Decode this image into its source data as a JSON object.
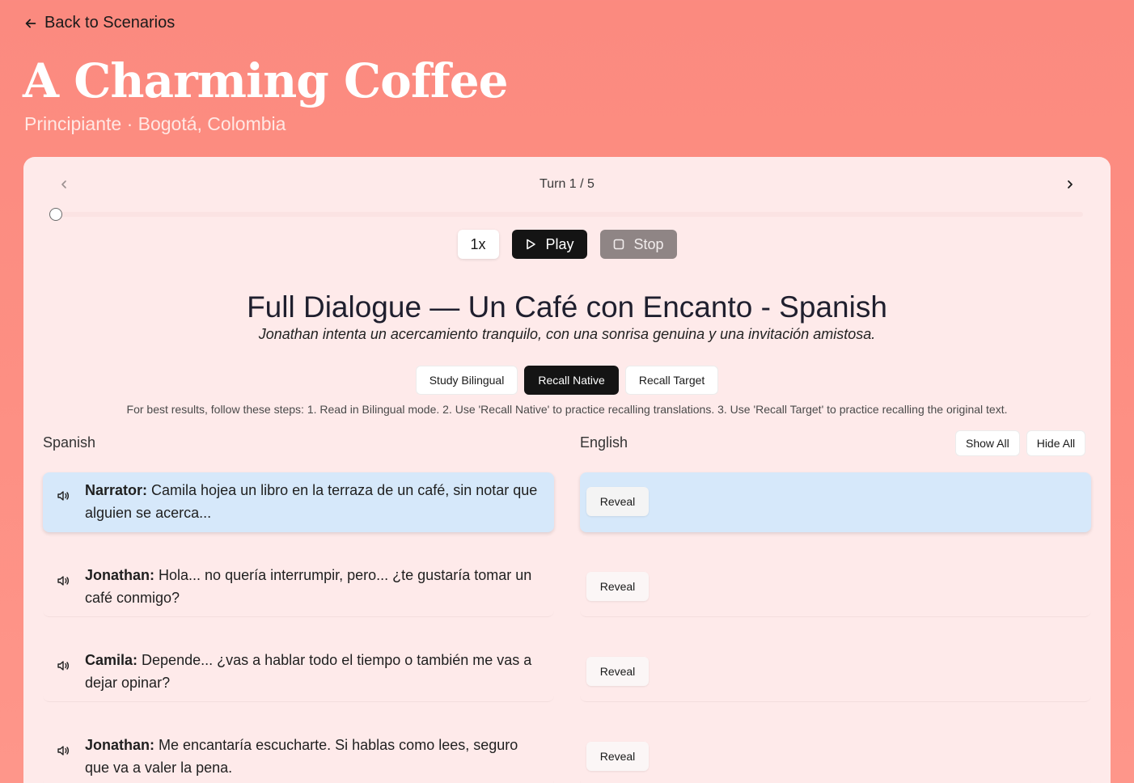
{
  "back_link": "Back to Scenarios",
  "scenario": {
    "title": "A Charming Coffee",
    "subtitle": "Principiante · Bogotá, Colombia"
  },
  "turn": {
    "label": "Turn 1 / 5",
    "current": 1,
    "total": 5
  },
  "playback": {
    "speed": "1x",
    "play": "Play",
    "stop": "Stop"
  },
  "dialogue": {
    "title": "Full Dialogue — Un Café con Encanto - Spanish",
    "description": "Jonathan intenta un acercamiento tranquilo, con una sonrisa genuina y una invitación amistosa."
  },
  "modes": {
    "study": "Study Bilingual",
    "recall_native": "Recall Native",
    "recall_target": "Recall Target",
    "active": "recall_native"
  },
  "instructions": "For best results, follow these steps: 1. Read in Bilingual mode. 2. Use 'Recall Native' to practice recalling translations. 3. Use 'Recall Target' to practice recalling the original text.",
  "columns": {
    "native": "Spanish",
    "target": "English",
    "show_all": "Show All",
    "hide_all": "Hide All"
  },
  "lines": [
    {
      "speaker": "Narrator:",
      "text": " Camila hojea un libro en la terraza de un café, sin notar que alguien se acerca...",
      "reveal": "Reveal"
    },
    {
      "speaker": "Jonathan:",
      "text": " Hola... no quería interrumpir, pero... ¿te gustaría tomar un café conmigo?",
      "reveal": "Reveal"
    },
    {
      "speaker": "Camila:",
      "text": " Depende... ¿vas a hablar todo el tiempo o también me vas a dejar opinar?",
      "reveal": "Reveal"
    },
    {
      "speaker": "Jonathan:",
      "text": " Me encantaría escucharte. Si hablas como lees, seguro que va a valer la pena.",
      "reveal": "Reveal"
    }
  ],
  "colors": {
    "background": "#fd8f83",
    "card": "#feeaea",
    "active_row": "#d6e8fa",
    "primary_button": "#141414",
    "stop_button": "#8f8585"
  }
}
